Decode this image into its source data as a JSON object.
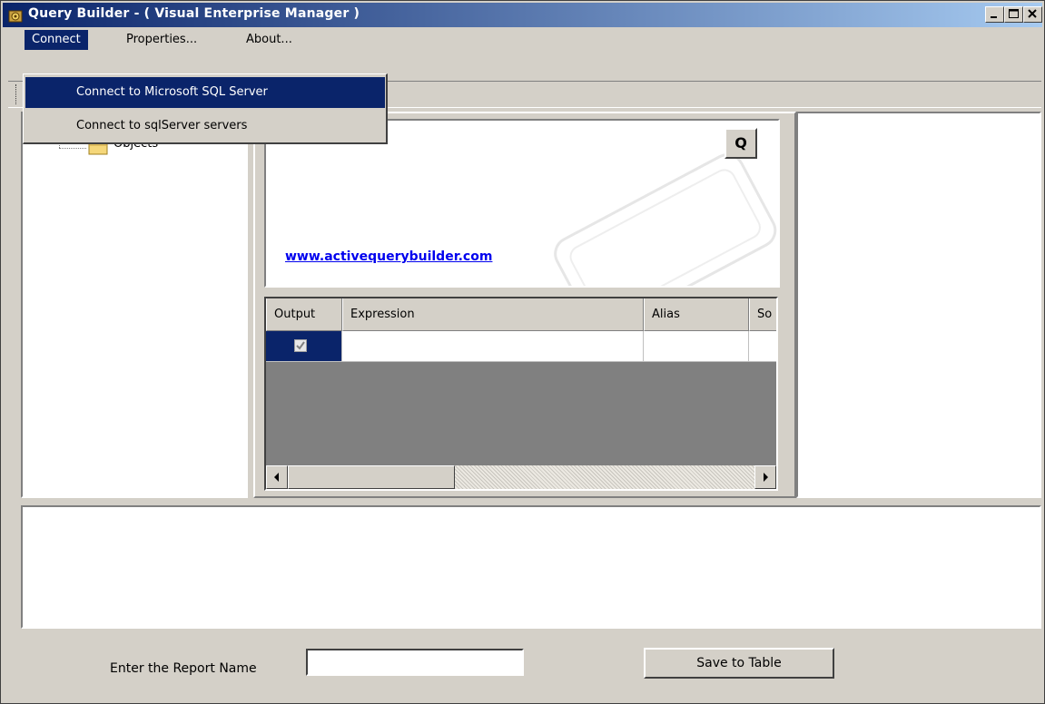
{
  "window": {
    "title": "Query Builder - ( Visual Enterprise Manager )"
  },
  "menubar": {
    "items": [
      {
        "label": "Connect"
      },
      {
        "label": "Properties..."
      },
      {
        "label": "About..."
      }
    ]
  },
  "connect_menu": {
    "items": [
      {
        "label": "Connect to Microsoft SQL Server"
      },
      {
        "label": "Connect to sqlServer servers"
      }
    ]
  },
  "tree": {
    "node_label": "Objects"
  },
  "query_area": {
    "q_button_label": "Q",
    "link_text": "www.activequerybuilder.com"
  },
  "grid": {
    "columns": [
      "Output",
      "Expression",
      "Alias",
      "So"
    ],
    "rows": [
      {
        "output_checked": true,
        "expression": "",
        "alias": "",
        "sort": ""
      }
    ]
  },
  "footer": {
    "report_label": "Enter the Report Name",
    "report_value": "",
    "save_button_label": "Save to Table"
  },
  "icons": {
    "app": "gear-app-icon",
    "minimize": "minimize-icon",
    "maximize": "maximize-icon",
    "close": "close-icon",
    "folder": "folder-icon",
    "scroll_left": "arrow-left-icon",
    "scroll_right": "arrow-right-icon"
  },
  "colors": {
    "title_start": "#0a246a",
    "title_end": "#a6caf0",
    "highlight": "#0a246a",
    "face": "#d4d0c8",
    "grid_empty": "#808080",
    "link": "#0000ee"
  }
}
